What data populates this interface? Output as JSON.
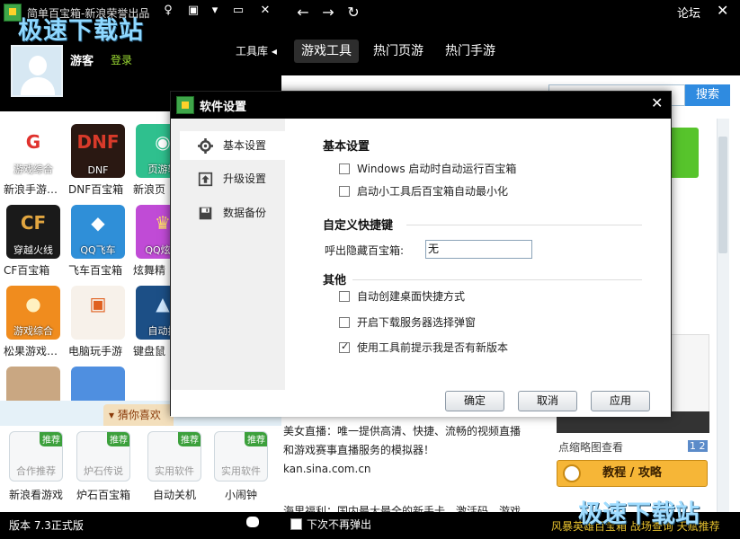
{
  "app": {
    "title": "简单百宝箱-新浪荣誉出品",
    "watermark": "极速下载站"
  },
  "user": {
    "name": "游客",
    "login": "登录",
    "toolbox": "工具库"
  },
  "tools": [
    {
      "badge": "游戏综合",
      "glyph": "G",
      "label": "新浪手游…",
      "bg": "#ffffff",
      "fg": "#e0322d"
    },
    {
      "badge": "DNF",
      "glyph": "DNF",
      "label": "DNF百宝箱",
      "bg": "#2a1812",
      "fg": "#d83a2a"
    },
    {
      "badge": "页游辅",
      "glyph": "◉",
      "label": "新浪页",
      "bg": "#2fc08e",
      "fg": "#ffffff"
    },
    {
      "badge": "穿越火线",
      "glyph": "CF",
      "label": "CF百宝箱",
      "bg": "#1a1a1a",
      "fg": "#e2a640"
    },
    {
      "badge": "QQ飞车",
      "glyph": "◆",
      "label": "飞车百宝箱",
      "bg": "#2f8fd8",
      "fg": "#ffffff"
    },
    {
      "badge": "QQ炫舞",
      "glyph": "♛",
      "label": "炫舞精",
      "bg": "#c04bd6",
      "fg": "#ffe066"
    },
    {
      "badge": "游戏综合",
      "glyph": "●",
      "label": "松果游戏…",
      "bg": "#f08c1e",
      "fg": "#fff1c0"
    },
    {
      "badge": "",
      "glyph": "▣",
      "label": "电脑玩手游",
      "bg": "#f7f1ea",
      "fg": "#e06020"
    },
    {
      "badge": "自动按",
      "glyph": "▲",
      "label": "键盘鼠",
      "bg": "#1c4f86",
      "fg": "#cfe8ff"
    },
    {
      "badge": "",
      "glyph": "",
      "label": "",
      "bg": "#c9a782",
      "fg": "#ffffff"
    },
    {
      "badge": "",
      "glyph": "",
      "label": "",
      "bg": "#4f8fe0",
      "fg": "#ffffff"
    }
  ],
  "guess": {
    "label": "猜你喜欢",
    "items": [
      {
        "tag": "推荐",
        "caption": "合作推荐",
        "label": "新浪看游戏"
      },
      {
        "tag": "推荐",
        "caption": "炉石传说",
        "label": "炉石百宝箱"
      },
      {
        "tag": "推荐",
        "caption": "实用软件",
        "label": "自动关机"
      },
      {
        "tag": "推荐",
        "caption": "实用软件",
        "label": "小闹钟"
      }
    ]
  },
  "status": {
    "version": "版本 7.3正式版"
  },
  "right": {
    "forum": "论坛",
    "tabs": [
      "游戏工具",
      "热门页游",
      "热门手游"
    ],
    "search_button": "搜索",
    "content": {
      "line1": "美女直播：唯一提供高清、快捷、流畅的视频直播",
      "line2": "和游戏赛事直播服务的模拟器！",
      "line3": "kan.sina.com.cn",
      "line4": "海里福利：国内最大最全的新手卡、激活码、游戏",
      "thumb_caption": "点缩略图查看",
      "page_num": "1 2",
      "guide_button": "教程 / 攻略"
    },
    "bottom": {
      "noshow": "下次不再弹出",
      "links": "风暴英雄百宝箱 战场查询 天赋推荐"
    }
  },
  "dialog": {
    "title": "软件设置",
    "sidebar": [
      {
        "label": "基本设置",
        "active": true
      },
      {
        "label": "升级设置",
        "active": false
      },
      {
        "label": "数据备份",
        "active": false
      }
    ],
    "basic": {
      "title": "基本设置",
      "opt1": "Windows 启动时自动运行百宝箱",
      "opt2": "启动小工具后百宝箱自动最小化"
    },
    "hotkey": {
      "title": "自定义快捷键",
      "label": "呼出隐藏百宝箱:",
      "value": "无"
    },
    "other": {
      "title": "其他",
      "opt1": "自动创建桌面快捷方式",
      "opt2": "开启下载服务器选择弹窗",
      "opt3": "使用工具前提示我是否有新版本"
    },
    "buttons": {
      "ok": "确定",
      "cancel": "取消",
      "apply": "应用"
    }
  }
}
